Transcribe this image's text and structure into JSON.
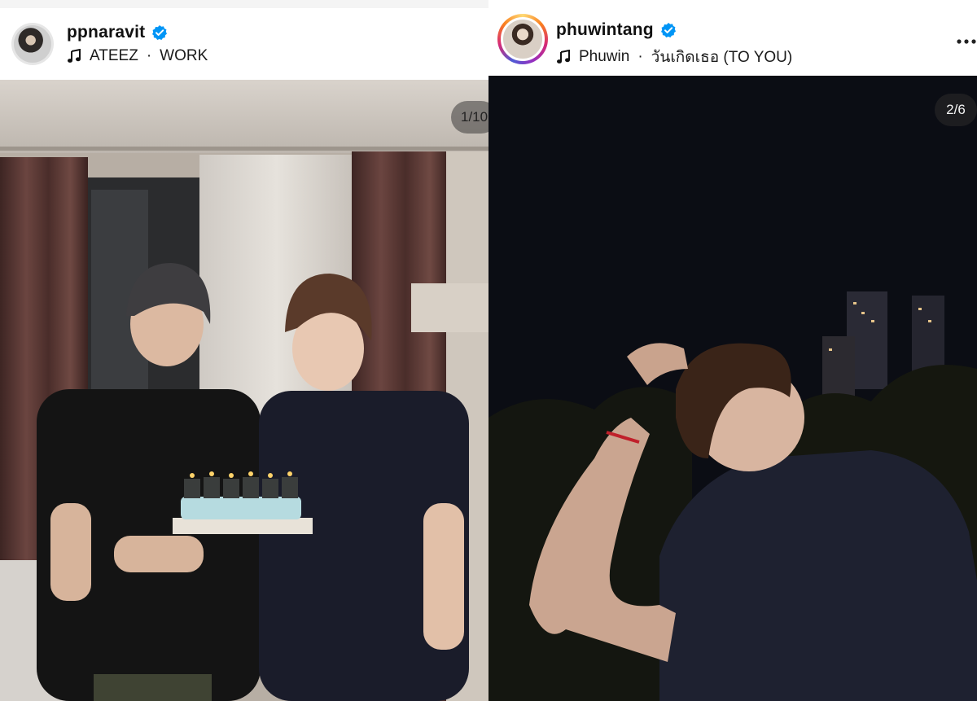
{
  "posts": [
    {
      "username": "ppnaravit",
      "verified": true,
      "music": {
        "artist": "ATEEZ",
        "separator": "·",
        "title": "WORK"
      },
      "counter": "1/10",
      "photo_description_icon": "photo-two-people-birthday-cake"
    },
    {
      "username": "phuwintang",
      "verified": true,
      "music": {
        "artist": "Phuwin",
        "separator": "·",
        "title": "วันเกิดเธอ (TO YOU)"
      },
      "counter": "2/6",
      "photo_description_icon": "photo-night-portrait"
    }
  ],
  "colors": {
    "verified_blue": "#0095f6",
    "story_ring": "#d62976",
    "night_sky": "#0b0d14"
  },
  "icons": [
    "verified-badge-icon",
    "music-note-icon",
    "more-options-icon"
  ]
}
